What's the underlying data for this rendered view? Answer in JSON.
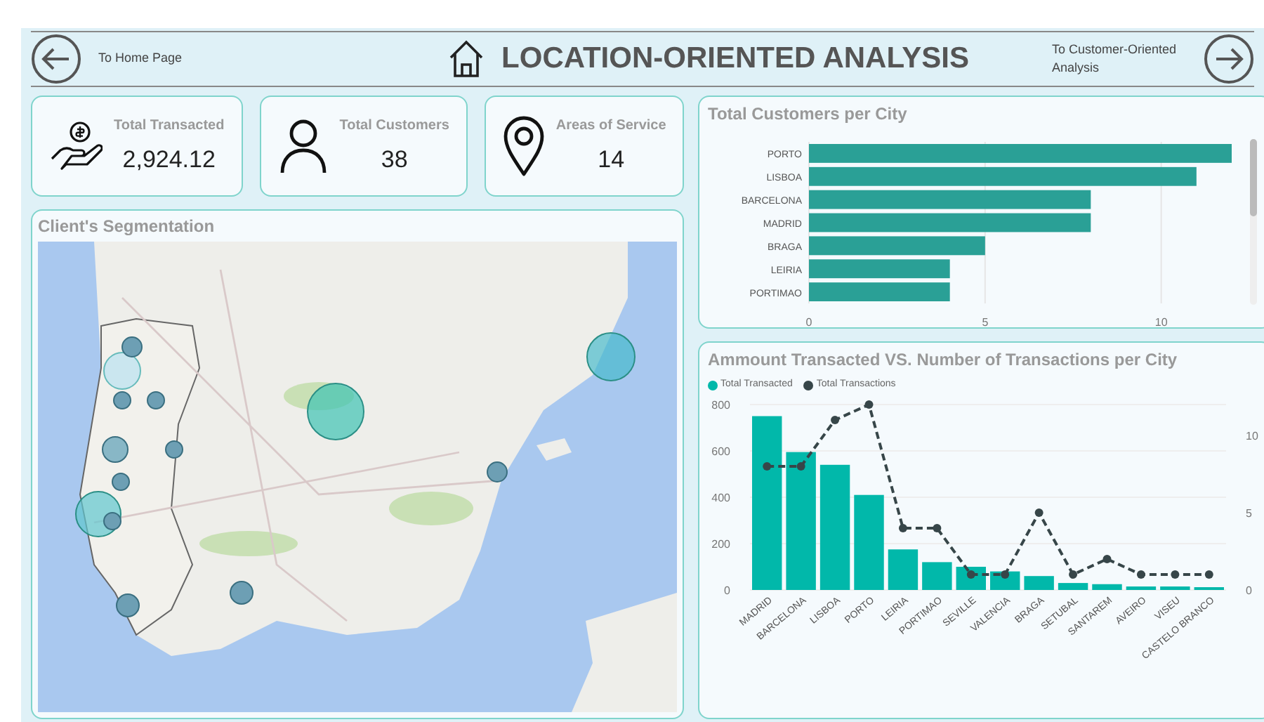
{
  "header": {
    "back_label": "To Home Page",
    "title": "LOCATION-ORIENTED ANALYSIS",
    "next_label": "To Customer-Oriented Analysis"
  },
  "kpis": [
    {
      "kind": "money",
      "label": "Total Transacted",
      "value": "2,924.12"
    },
    {
      "kind": "person",
      "label": "Total Customers",
      "value": "38"
    },
    {
      "kind": "pin",
      "label": "Areas of Service",
      "value": "14"
    }
  ],
  "map_panel": {
    "title": "Client's Segmentation"
  },
  "customers_chart": {
    "chart_data": {
      "type": "bar",
      "title": "Total Customers per City",
      "orientation": "horizontal",
      "categories": [
        "PORTO",
        "LISBOA",
        "BARCELONA",
        "MADRID",
        "BRAGA",
        "LEIRIA",
        "PORTIMAO"
      ],
      "series": [
        {
          "color": "#2aa096",
          "values": [
            12,
            11,
            8,
            8,
            5,
            4,
            4
          ]
        }
      ],
      "xlim": [
        0,
        12
      ],
      "xticks": [
        0,
        5,
        10
      ]
    }
  },
  "transactions_chart": {
    "chart_data": {
      "type": "bar",
      "title": "Ammount Transacted VS. Number of Transactions per City",
      "categories": [
        "MADRID",
        "BARCELONA",
        "LISBOA",
        "PORTO",
        "LEIRIA",
        "PORTIMAO",
        "SEVILLE",
        "VALENCIA",
        "BRAGA",
        "SETUBAL",
        "SANTAREM",
        "AVEIRO",
        "VISEU",
        "CASTELO BRANCO"
      ],
      "series": [
        {
          "name": "Total Transacted",
          "color": "#01b8aa",
          "type": "bar",
          "values": [
            750,
            595,
            540,
            410,
            175,
            120,
            100,
            80,
            60,
            30,
            25,
            15,
            15,
            12
          ]
        },
        {
          "name": "Total Transactions",
          "color": "#374649",
          "type": "line",
          "axis": "y2",
          "line_style": "dashed",
          "marker": "circle",
          "values": [
            8,
            8,
            11,
            12,
            4,
            4,
            1,
            1,
            5,
            1,
            2,
            1,
            1,
            1
          ]
        }
      ],
      "grid": true,
      "ylim": [
        0,
        800
      ],
      "yticks": [
        0,
        200,
        400,
        600,
        800
      ],
      "y2lim": [
        0,
        12
      ],
      "y2ticks": [
        0,
        5,
        10
      ]
    }
  }
}
